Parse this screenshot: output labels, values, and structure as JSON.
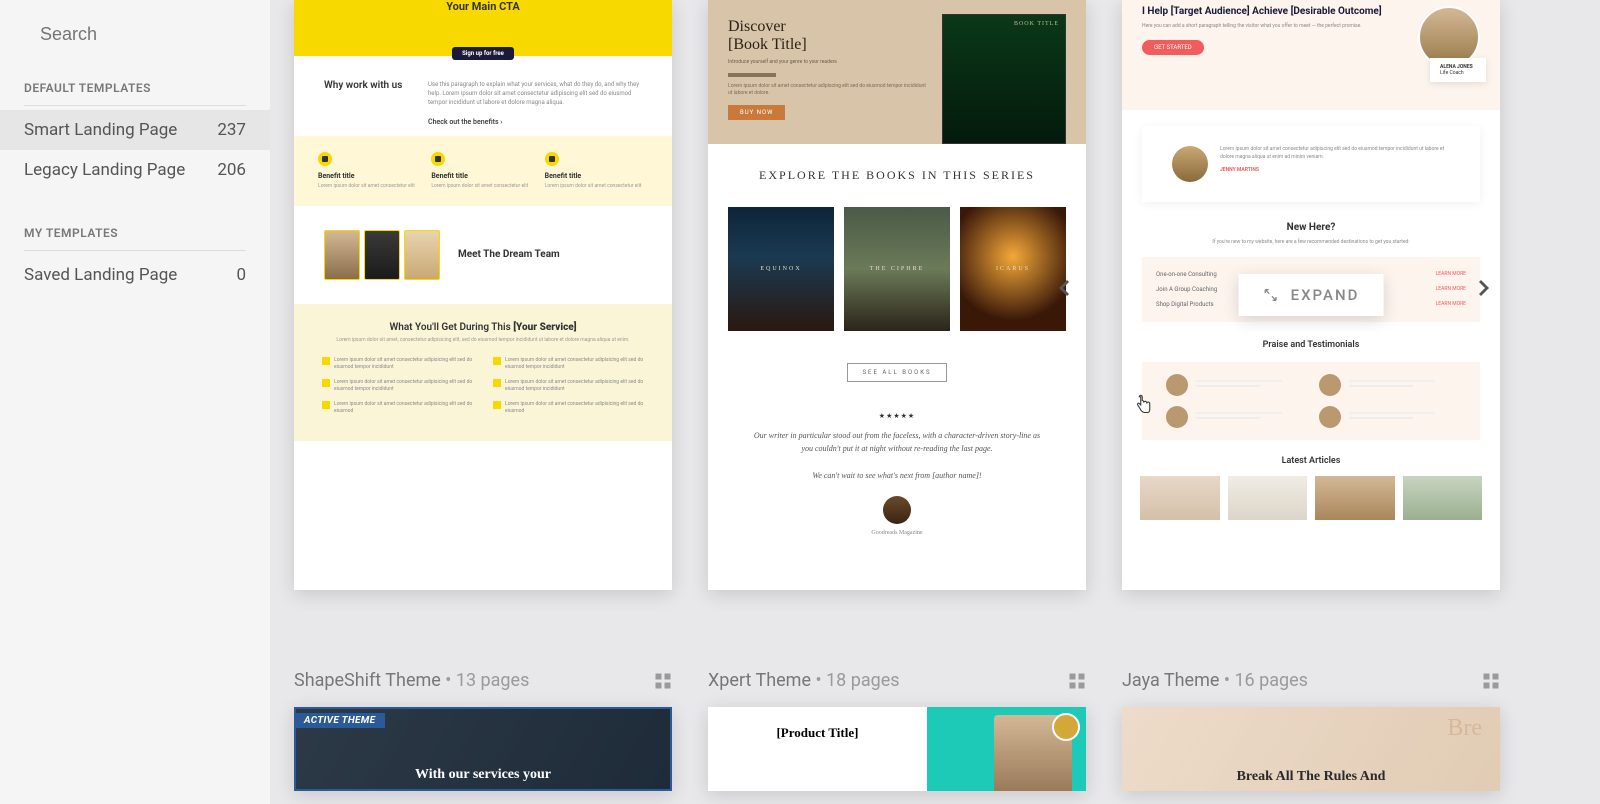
{
  "search": {
    "placeholder": "Search"
  },
  "sidebar": {
    "default_header": "DEFAULT TEMPLATES",
    "my_header": "MY TEMPLATES",
    "items": [
      {
        "label": "Smart Landing Page",
        "count": "237"
      },
      {
        "label": "Legacy Landing Page",
        "count": "206"
      }
    ],
    "my_items": [
      {
        "label": "Saved Landing Page",
        "count": "0"
      }
    ]
  },
  "card1": {
    "hero_title": "Your Main CTA",
    "hero_btn": "Sign up for free",
    "why_title": "Why work with us",
    "why_sub": "Check out the benefits ›",
    "benefit_title": "Benefit title",
    "team_title": "Meet The Dream Team",
    "what_title_a": "What You'll Get During This ",
    "what_title_b": "[Your Service]"
  },
  "card2": {
    "discover_a": "Discover",
    "discover_b": "[Book Title]",
    "buy": "BUY NOW",
    "book_badge": "BOOK TITLE",
    "explore": "EXPLORE THE BOOKS IN THIS SERIES",
    "books": [
      "EQUINOX",
      "THE CIPHRE",
      "ICARUS"
    ],
    "see_all": "SEE ALL BOOKS",
    "stars": "★★★★★",
    "review": "Our writer in particular stood out from the faceless, with a character-driven story-line as you couldn't put it at night without re-reading the last page.",
    "review2": "We can't wait to see what's next from [author name]!"
  },
  "card3": {
    "hero_title": "I Help [Target Audience] Achieve [Desirable Outcome]",
    "cta": "GET STARTED",
    "testi_name": "JENNY MARTINS",
    "new_here": "New Here?",
    "new_here_sub": "If you're new to my website, here are a few recommended destinations to get you started:",
    "links": [
      {
        "l": "One-on-one Consulting",
        "r": "LEARN MORE"
      },
      {
        "l": "Join A Group Coaching",
        "r": "LEARN MORE"
      },
      {
        "l": "Shop Digital Products",
        "r": "LEARN MORE"
      }
    ],
    "praise": "Praise and Testimonials",
    "latest": "Latest Articles",
    "expand": "EXPAND"
  },
  "themes": [
    {
      "name": "ShapeShift Theme",
      "pages": "13 pages",
      "active_badge": "ACTIVE THEME",
      "preview_title": "With our services your"
    },
    {
      "name": "Xpert Theme",
      "pages": "18 pages",
      "preview_title": "[Product Title]"
    },
    {
      "name": "Jaya Theme",
      "pages": "16 pages",
      "preview_title": "Break All The Rules And",
      "script": "Bre"
    }
  ]
}
